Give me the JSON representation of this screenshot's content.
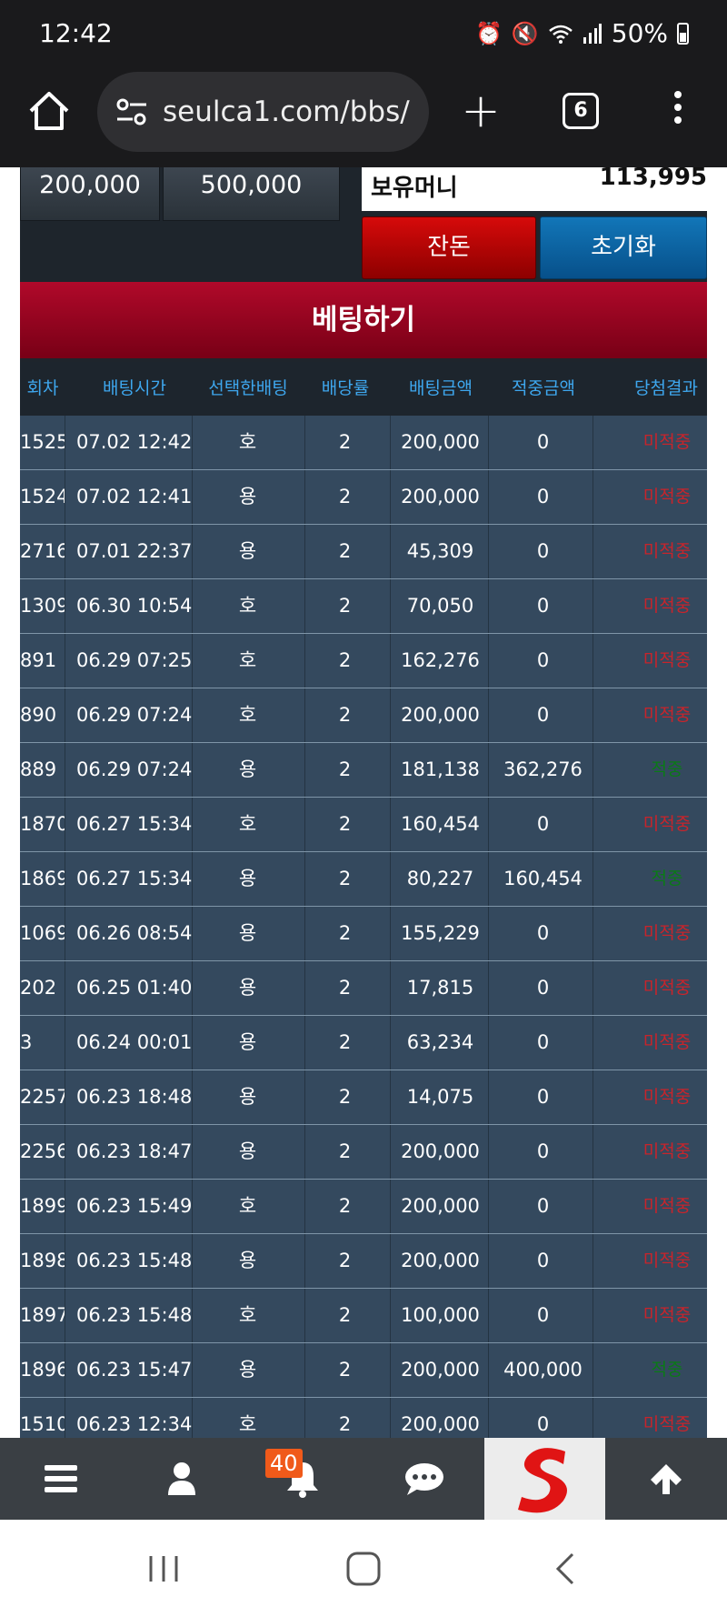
{
  "status": {
    "time": "12:42",
    "battery": "50%",
    "icons": [
      "alarm-icon",
      "mute-icon",
      "wifi-icon",
      "signal-icon",
      "battery-icon"
    ]
  },
  "browser": {
    "url": "seulca1.com/bbs/",
    "tab_count": "6"
  },
  "chips": [
    "200,000",
    "500,000"
  ],
  "balance": {
    "label": "보유머니",
    "value": "113,995"
  },
  "buttons": {
    "change": "잔돈",
    "reset": "초기화",
    "bet": "베팅하기"
  },
  "table": {
    "headers": [
      "회차",
      "배팅시간",
      "선택한배팅",
      "배당률",
      "배팅금액",
      "적중금액",
      "당첨결과"
    ],
    "rows": [
      [
        "1525",
        "07.02 12:42",
        "호",
        "2",
        "200,000",
        "0",
        "미적중"
      ],
      [
        "1524",
        "07.02 12:41",
        "용",
        "2",
        "200,000",
        "0",
        "미적중"
      ],
      [
        "2716",
        "07.01 22:37",
        "용",
        "2",
        "45,309",
        "0",
        "미적중"
      ],
      [
        "1309",
        "06.30 10:54",
        "호",
        "2",
        "70,050",
        "0",
        "미적중"
      ],
      [
        "891",
        "06.29 07:25",
        "호",
        "2",
        "162,276",
        "0",
        "미적중"
      ],
      [
        "890",
        "06.29 07:24",
        "호",
        "2",
        "200,000",
        "0",
        "미적중"
      ],
      [
        "889",
        "06.29 07:24",
        "용",
        "2",
        "181,138",
        "362,276",
        "적중"
      ],
      [
        "1870",
        "06.27 15:34",
        "호",
        "2",
        "160,454",
        "0",
        "미적중"
      ],
      [
        "1869",
        "06.27 15:34",
        "용",
        "2",
        "80,227",
        "160,454",
        "적중"
      ],
      [
        "1069",
        "06.26 08:54",
        "용",
        "2",
        "155,229",
        "0",
        "미적중"
      ],
      [
        "202",
        "06.25 01:40",
        "용",
        "2",
        "17,815",
        "0",
        "미적중"
      ],
      [
        "3",
        "06.24 00:01",
        "용",
        "2",
        "63,234",
        "0",
        "미적중"
      ],
      [
        "2257",
        "06.23 18:48",
        "용",
        "2",
        "14,075",
        "0",
        "미적중"
      ],
      [
        "2256",
        "06.23 18:47",
        "용",
        "2",
        "200,000",
        "0",
        "미적중"
      ],
      [
        "1899",
        "06.23 15:49",
        "호",
        "2",
        "200,000",
        "0",
        "미적중"
      ],
      [
        "1898",
        "06.23 15:48",
        "용",
        "2",
        "200,000",
        "0",
        "미적중"
      ],
      [
        "1897",
        "06.23 15:48",
        "호",
        "2",
        "100,000",
        "0",
        "미적중"
      ],
      [
        "1896",
        "06.23 15:47",
        "용",
        "2",
        "200,000",
        "400,000",
        "적중"
      ],
      [
        "1510",
        "06.23 12:34",
        "호",
        "2",
        "200,000",
        "0",
        "미적중"
      ]
    ],
    "result_colors": {
      "miss": "#c8242b",
      "hit": "#0a7a16"
    }
  },
  "bottom_nav": {
    "notification_count": "40",
    "icons": [
      "menu-icon",
      "user-icon",
      "bell-icon",
      "chat-icon",
      "site-logo",
      "arrow-up-icon"
    ]
  },
  "colors": {
    "bet_banner": "#a0061f",
    "header_text": "#3ea7ee",
    "row_bg": "#34495e",
    "change_button": "#c00808",
    "reset_button": "#0b63a3"
  }
}
